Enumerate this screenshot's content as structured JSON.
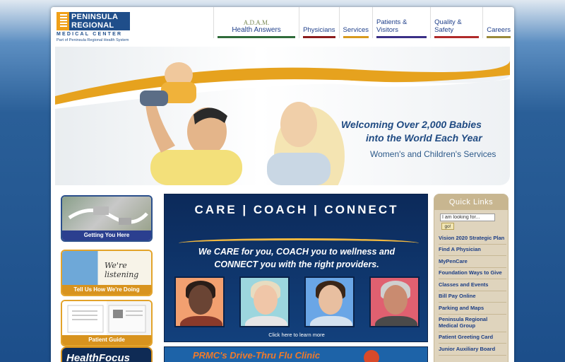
{
  "header": {
    "logo": {
      "line1": "PENINSULA",
      "line2": "REGIONAL",
      "line3": "MEDICAL CENTER",
      "tagline": "Part of Peninsula Regional Health System"
    },
    "nav": [
      {
        "label": "Health Answers",
        "brand": "A.D.A.M.",
        "color": "#2f6b3a"
      },
      {
        "label": "Physicians",
        "color": "#8c1c1c"
      },
      {
        "label": "Services",
        "color": "#d89a1e"
      },
      {
        "label": "Patients & Visitors",
        "color": "#3a2f86"
      },
      {
        "label": "Quality & Safety",
        "color": "#b02a2a"
      },
      {
        "label": "Careers",
        "color": "#9a8a3a"
      }
    ]
  },
  "hero": {
    "line1": "Welcoming Over 2,000 Babies",
    "line2": "into the World Each Year",
    "line3": "Women's and Children's Services"
  },
  "left_cards": [
    {
      "label": "Getting You Here"
    },
    {
      "label": "Tell Us How We're Doing",
      "script_text": "We're listening"
    },
    {
      "label": "Patient Guide"
    },
    {
      "label": "HealthFocus"
    }
  ],
  "center": {
    "heading": "CARE | COACH | CONNECT",
    "tagline1": "We CARE for you, COACH you to wellness and",
    "tagline2": "CONNECT you with the right providers.",
    "link": "Click here to learn more"
  },
  "bottom_banner": {
    "text": "PRMC's Drive-Thru Flu Clinic"
  },
  "quick_links": {
    "title": "Quick Links",
    "search_placeholder": "I am looking for...",
    "go_label": "go!",
    "items": [
      "Vision 2020 Strategic Plan",
      "Find A Physician",
      "MyPenCare",
      "Foundation Ways to Give",
      "Classes and Events",
      "Bill Pay Online",
      "Parking and Maps",
      "Peninsula Regional Medical Group",
      "Patient Greeting Card",
      "Junior Auxiliary Board"
    ]
  },
  "colors": {
    "brand_navy": "#1f4e8a",
    "accent_gold": "#e3a32a",
    "quick_links_bg": "#dfd4bd"
  }
}
